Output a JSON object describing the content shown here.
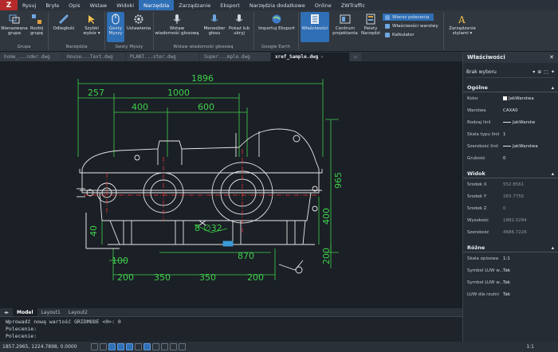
{
  "menubar": {
    "logo": "Z",
    "items": [
      "Rysuj",
      "Bryła",
      "Opis",
      "Wstaw",
      "Widoki",
      "Narzędzia",
      "Zarządzanie",
      "Eksport",
      "Narzędzia dodatkowe",
      "Online",
      "ZWTraffic"
    ],
    "active": "Narzędzia"
  },
  "ribbon": {
    "buttons": [
      {
        "l1": "Nienazwana",
        "l2": "grupa"
      },
      {
        "l1": "Rozbij",
        "l2": "grupę"
      },
      {
        "l1": "Odległość",
        "l2": ""
      },
      {
        "l1": "Szybki",
        "l2": "wybór ▾"
      },
      {
        "l1": "Gesty",
        "l2": "Myszy"
      },
      {
        "l1": "Ustawienia",
        "l2": ""
      },
      {
        "l1": "Wstaw",
        "l2": "wiadomość głosową"
      },
      {
        "l1": "Menedżer",
        "l2": "głosu"
      },
      {
        "l1": "Pokaż lub",
        "l2": "ukryj"
      },
      {
        "l1": "Importuj Eksport",
        "l2": ""
      },
      {
        "l1": "Właściwości",
        "l2": ""
      },
      {
        "l1": "Centrum",
        "l2": "projektanta"
      },
      {
        "l1": "Palety",
        "l2": "Narzędzi"
      },
      {
        "l1": "Zarządzanie",
        "l2": "stylami ▾"
      }
    ],
    "small": [
      "Wiersz polecenia",
      "Właściwości warstwy",
      "Kalkulator"
    ],
    "groups": [
      "Grupa",
      "Narzędzia",
      "Gesty Myszy",
      "Wstaw wiadomość głosową",
      "Google Earth"
    ]
  },
  "doctabs": [
    "home_...nder.dwg",
    "House...Text.dwg",
    "PLANT...ster.dwg",
    "Super...mple.dwg",
    "xref_Sample.dwg"
  ],
  "drawing": {
    "dims": [
      "1896",
      "257",
      "1000",
      "400",
      "600",
      "965",
      "400",
      "40",
      "8",
      "∅32",
      "870",
      "100",
      "200",
      "350",
      "350",
      "200",
      "200"
    ]
  },
  "layouttabs": [
    "Model",
    "Layout1",
    "Layout2"
  ],
  "command": {
    "line1": "Wprowadź nową wartość GRIDMODE  <0>: 0",
    "line2": "Polecenie:",
    "line3": "Polecenie:"
  },
  "status": {
    "coords": "1857.2965, 1224.7898, 0.0000",
    "scale": "1:1"
  },
  "properties": {
    "title": "Właściwości",
    "selection": "Brak wyboru",
    "sections": [
      {
        "name": "Ogólne",
        "rows": [
          {
            "k": "Kolor",
            "v": "JakWarstwa",
            "swatch": true
          },
          {
            "k": "Warstwa",
            "v": "CAXA0"
          },
          {
            "k": "Rodzaj linii",
            "v": "JakWarstw",
            "line": true
          },
          {
            "k": "Skala typu linii",
            "v": "1"
          },
          {
            "k": "Szerokość linii",
            "v": "JakWarstwa",
            "line": true
          },
          {
            "k": "Grubość",
            "v": "0"
          }
        ]
      },
      {
        "name": "Widok",
        "rows": [
          {
            "k": "Środek X",
            "v": "552.8561",
            "dim": true
          },
          {
            "k": "Środek Y",
            "v": "283.7755",
            "dim": true
          },
          {
            "k": "Środek Z",
            "v": "0",
            "dim": true
          },
          {
            "k": "Wysokość",
            "v": "1882.0284",
            "dim": true
          },
          {
            "k": "Szerokość",
            "v": "4686.7226",
            "dim": true
          }
        ]
      },
      {
        "name": "Różne",
        "rows": [
          {
            "k": "Skala opisowa",
            "v": "1:1"
          },
          {
            "k": "Symbol LUW w...",
            "v": "Tak"
          },
          {
            "k": "Symbol LUW w...",
            "v": "Tak"
          },
          {
            "k": "LUW dla rzutni",
            "v": "Tak"
          }
        ]
      }
    ]
  },
  "colors": {
    "accent": "#2f6fb5",
    "dim": "#3fd14a",
    "drawing": "#e8e8e8",
    "center": "#ff3b3b"
  }
}
